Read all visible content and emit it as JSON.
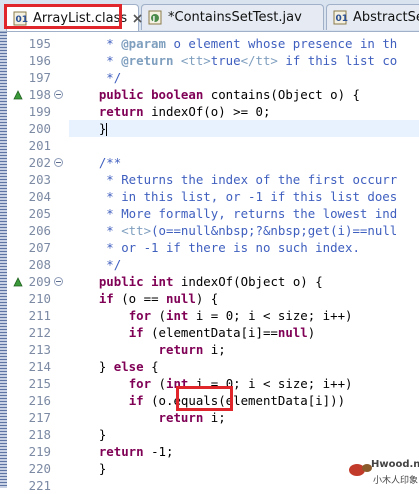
{
  "tabs": [
    {
      "label": "ArrayList.class",
      "dirty": false,
      "active": true
    },
    {
      "label": "*ContainsSetTest.jav",
      "active": false
    },
    {
      "label": "AbstractSet.",
      "active": false
    }
  ],
  "lines": [
    {
      "n": "195",
      "segs": [
        {
          "t": "     * ",
          "c": "cm"
        },
        {
          "t": "@param",
          "c": "tag"
        },
        {
          "t": " o element whose presence in th",
          "c": "cm"
        }
      ]
    },
    {
      "n": "196",
      "segs": [
        {
          "t": "     * ",
          "c": "cm"
        },
        {
          "t": "@return",
          "c": "tag"
        },
        {
          "t": " ",
          "c": "cm"
        },
        {
          "t": "<tt>",
          "c": "cmb"
        },
        {
          "t": "true",
          "c": "cm"
        },
        {
          "t": "</tt>",
          "c": "cmb"
        },
        {
          "t": " if this list co",
          "c": "cm"
        }
      ]
    },
    {
      "n": "197",
      "segs": [
        {
          "t": "     */",
          "c": "cm"
        }
      ]
    },
    {
      "n": "198",
      "segs": [
        {
          "t": "    ",
          "c": ""
        },
        {
          "t": "public",
          "c": "kw"
        },
        {
          "t": " ",
          "c": ""
        },
        {
          "t": "boolean",
          "c": "kw"
        },
        {
          "t": " contains(Object o) {",
          "c": ""
        }
      ]
    },
    {
      "n": "199",
      "segs": [
        {
          "t": "    ",
          "c": ""
        },
        {
          "t": "return",
          "c": "kw"
        },
        {
          "t": " indexOf(o) >= 0;",
          "c": ""
        }
      ]
    },
    {
      "n": "200",
      "segs": [
        {
          "t": "    }",
          "c": ""
        }
      ]
    },
    {
      "n": "201",
      "segs": []
    },
    {
      "n": "202",
      "segs": [
        {
          "t": "    /**",
          "c": "cm"
        }
      ]
    },
    {
      "n": "203",
      "segs": [
        {
          "t": "     * Returns the index of the first occurr",
          "c": "cm"
        }
      ]
    },
    {
      "n": "204",
      "segs": [
        {
          "t": "     * in this list, or -1 if this list does",
          "c": "cm"
        }
      ]
    },
    {
      "n": "205",
      "segs": [
        {
          "t": "     * More formally, returns the lowest ind",
          "c": "cm"
        }
      ]
    },
    {
      "n": "206",
      "segs": [
        {
          "t": "     * ",
          "c": "cm"
        },
        {
          "t": "<tt>",
          "c": "cmb"
        },
        {
          "t": "(o==null&nbsp;?&nbsp;get(i)==null",
          "c": "cm"
        }
      ]
    },
    {
      "n": "207",
      "segs": [
        {
          "t": "     * or -1 if there is no such index.",
          "c": "cm"
        }
      ]
    },
    {
      "n": "208",
      "segs": [
        {
          "t": "     */",
          "c": "cm"
        }
      ]
    },
    {
      "n": "209",
      "segs": [
        {
          "t": "    ",
          "c": ""
        },
        {
          "t": "public",
          "c": "kw"
        },
        {
          "t": " ",
          "c": ""
        },
        {
          "t": "int",
          "c": "kw"
        },
        {
          "t": " indexOf(Object o) {",
          "c": ""
        }
      ]
    },
    {
      "n": "210",
      "segs": [
        {
          "t": "    ",
          "c": ""
        },
        {
          "t": "if",
          "c": "kw"
        },
        {
          "t": " (o == ",
          "c": ""
        },
        {
          "t": "null",
          "c": "kw"
        },
        {
          "t": ") {",
          "c": ""
        }
      ]
    },
    {
      "n": "211",
      "segs": [
        {
          "t": "        ",
          "c": ""
        },
        {
          "t": "for",
          "c": "kw"
        },
        {
          "t": " (",
          "c": ""
        },
        {
          "t": "int",
          "c": "kw"
        },
        {
          "t": " i = 0; i < size; i++)",
          "c": ""
        }
      ]
    },
    {
      "n": "212",
      "segs": [
        {
          "t": "        ",
          "c": ""
        },
        {
          "t": "if",
          "c": "kw"
        },
        {
          "t": " (elementData[i]==",
          "c": ""
        },
        {
          "t": "null",
          "c": "kw"
        },
        {
          "t": ")",
          "c": ""
        }
      ]
    },
    {
      "n": "213",
      "segs": [
        {
          "t": "            ",
          "c": ""
        },
        {
          "t": "return",
          "c": "kw"
        },
        {
          "t": " i;",
          "c": ""
        }
      ]
    },
    {
      "n": "214",
      "segs": [
        {
          "t": "    } ",
          "c": ""
        },
        {
          "t": "else",
          "c": "kw"
        },
        {
          "t": " {",
          "c": ""
        }
      ]
    },
    {
      "n": "215",
      "segs": [
        {
          "t": "        ",
          "c": ""
        },
        {
          "t": "for",
          "c": "kw"
        },
        {
          "t": " (",
          "c": ""
        },
        {
          "t": "int",
          "c": "kw"
        },
        {
          "t": " i = 0; i < size; i++)",
          "c": ""
        }
      ]
    },
    {
      "n": "216",
      "segs": [
        {
          "t": "        ",
          "c": ""
        },
        {
          "t": "if",
          "c": "kw"
        },
        {
          "t": " (o.equals(elementData[i]))",
          "c": ""
        }
      ]
    },
    {
      "n": "217",
      "segs": [
        {
          "t": "            ",
          "c": ""
        },
        {
          "t": "return",
          "c": "kw"
        },
        {
          "t": " i;",
          "c": ""
        }
      ]
    },
    {
      "n": "218",
      "segs": [
        {
          "t": "    }",
          "c": ""
        }
      ]
    },
    {
      "n": "219",
      "segs": [
        {
          "t": "    ",
          "c": ""
        },
        {
          "t": "return",
          "c": "kw"
        },
        {
          "t": " -1;",
          "c": ""
        }
      ]
    },
    {
      "n": "220",
      "segs": [
        {
          "t": "    }",
          "c": ""
        }
      ]
    },
    {
      "n": "221",
      "segs": []
    }
  ],
  "current_line": "200",
  "watermark": {
    "brand": "Hwood.net",
    "sub": "小木人印象"
  },
  "colors": {
    "keyword": "#7f0055",
    "comment": "#3f5fbf",
    "javadoc_tag": "#7f9fbf",
    "highlight_box": "#e0262b"
  },
  "icons": {
    "tab_file": "java-class-icon",
    "tab_close": "close-icon",
    "override": "override-triangle-icon",
    "fold": "fold-collapse-icon"
  }
}
